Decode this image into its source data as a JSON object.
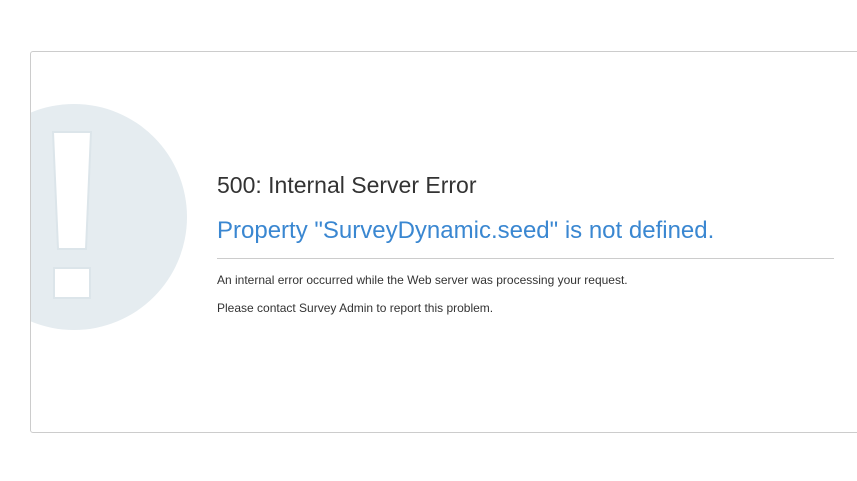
{
  "error": {
    "code_title": "500: Internal Server Error",
    "message": "Property \"SurveyDynamic.seed\" is not defined.",
    "details": [
      "An internal error occurred while the Web server was processing your request.",
      "Please contact Survey Admin to report this problem."
    ]
  },
  "icons": {
    "alert": "exclamation-mark-icon"
  },
  "colors": {
    "message": "#3a87d1",
    "icon_circle": "#e5ecf0",
    "border": "#cccccc"
  }
}
